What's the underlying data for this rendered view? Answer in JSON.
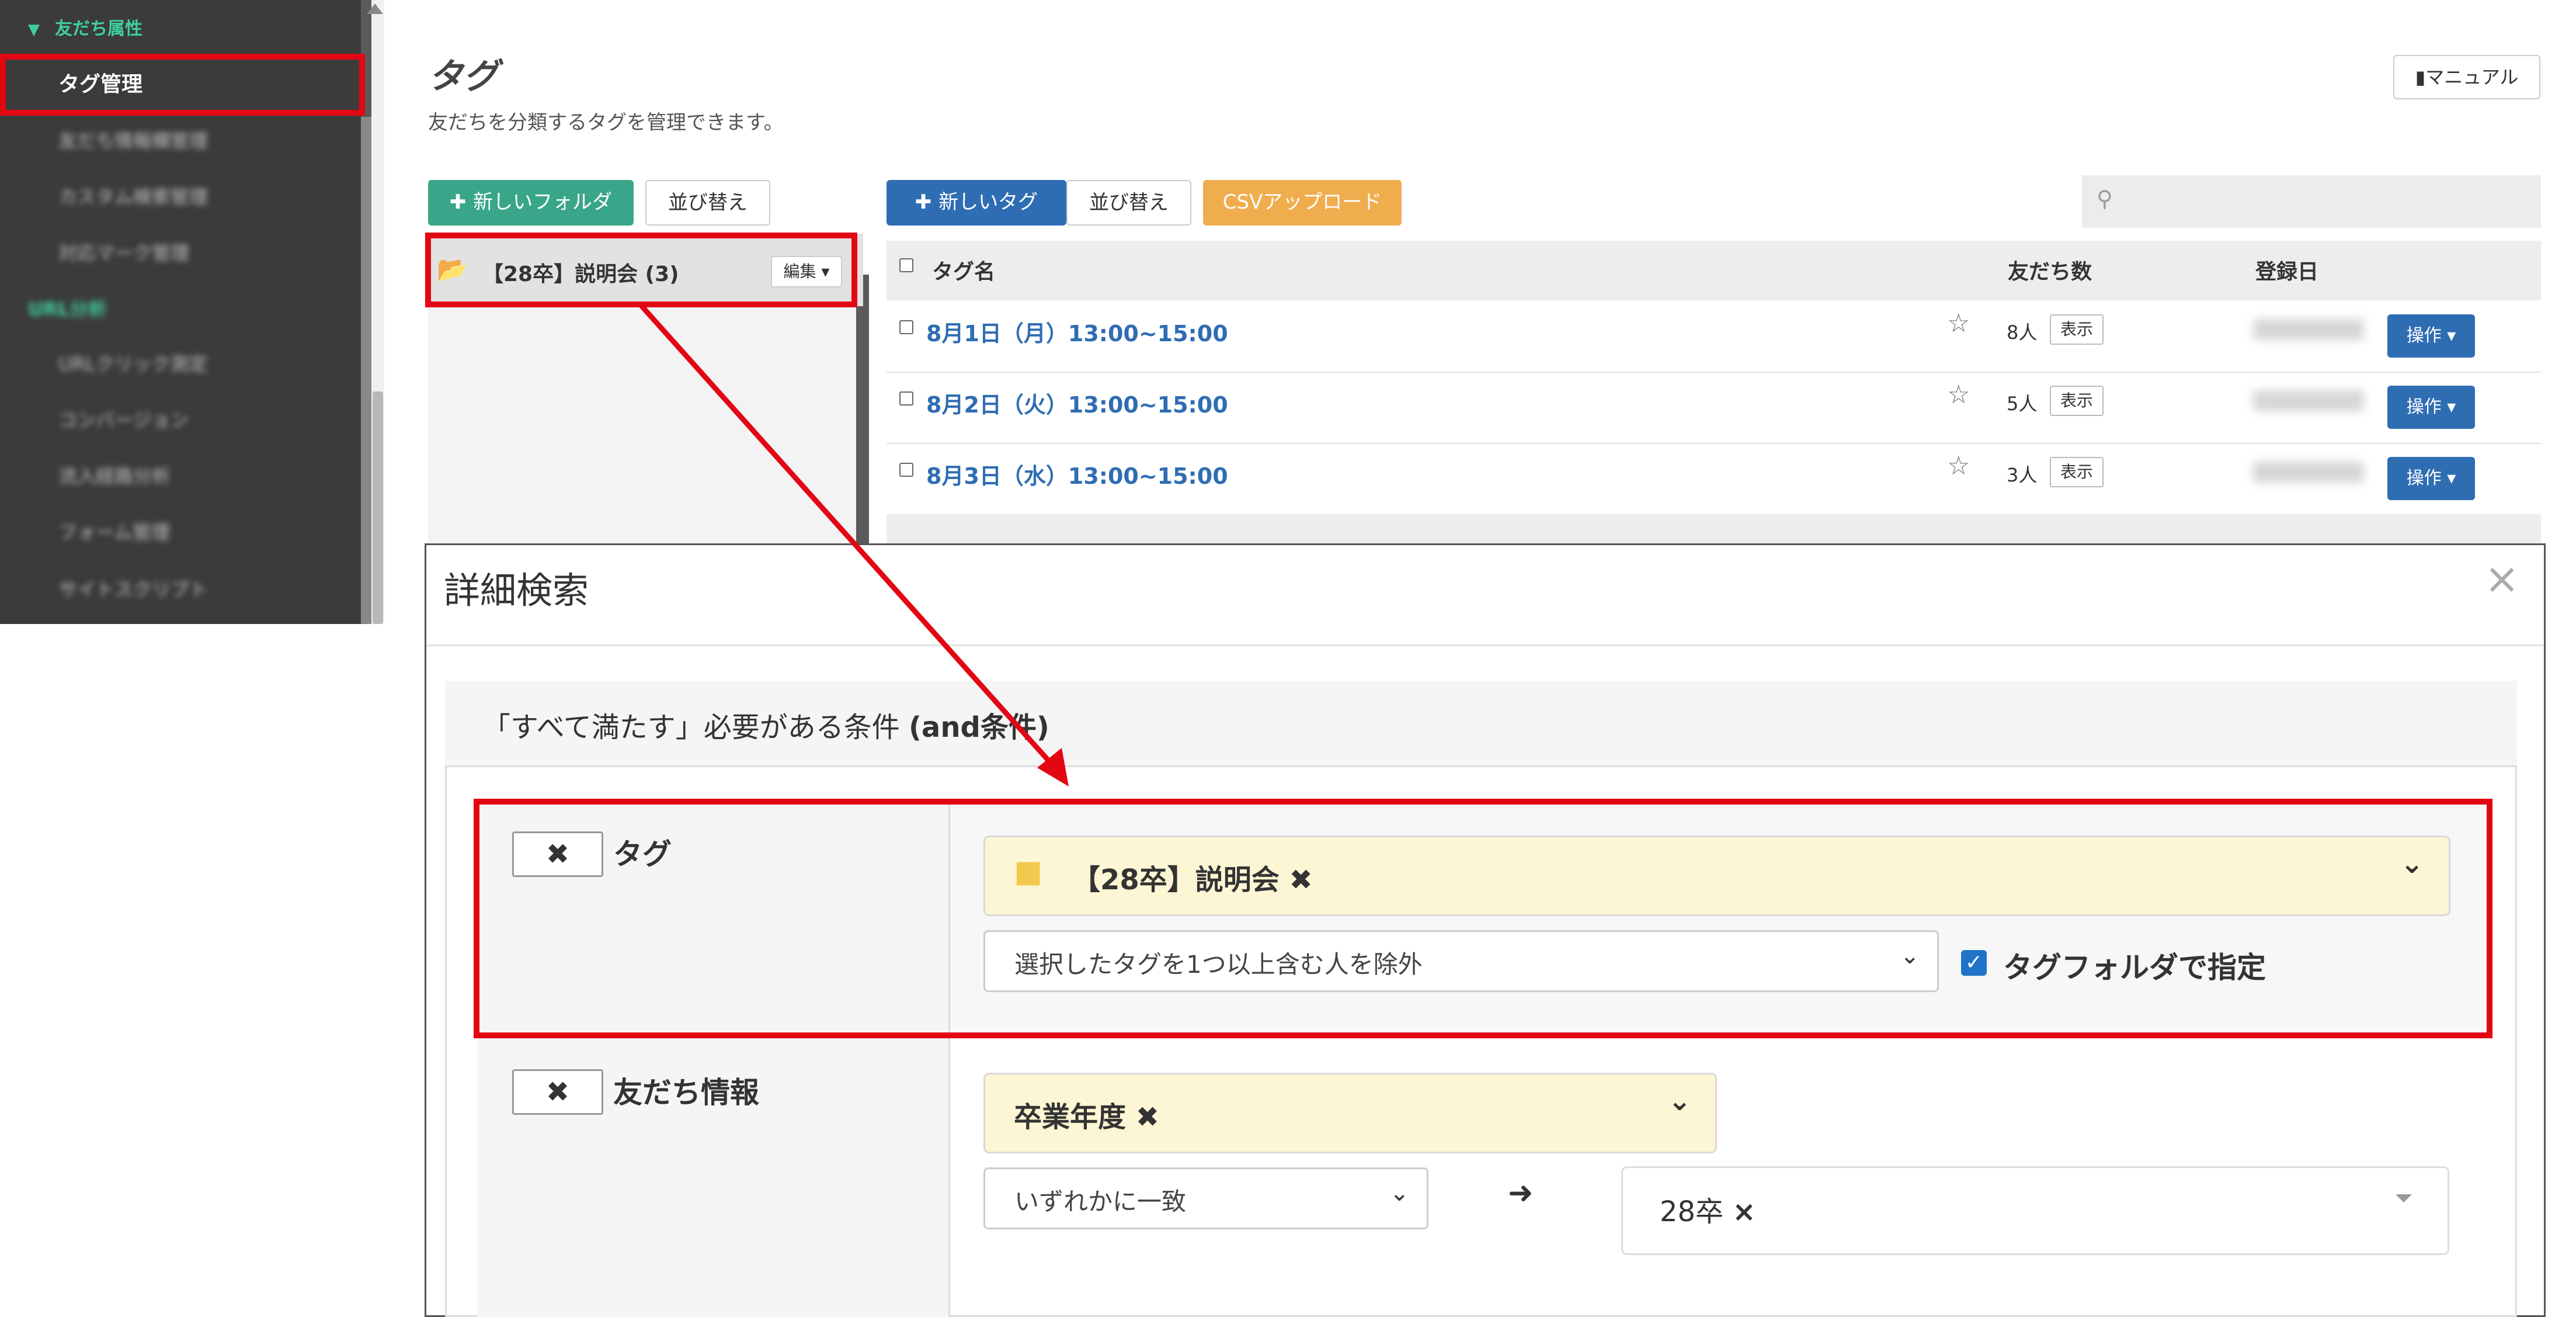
{
  "sidebar": {
    "section_label": "友だち属性",
    "active_item": "タグ管理",
    "blurred_items": [
      "友だち情報欄管理",
      "カスタム検索管理",
      "対応マーク管理",
      "URL分析",
      "URLクリック測定",
      "コンバージョン",
      "流入経路分析",
      "フォーム管理",
      "サイトスクリプト"
    ]
  },
  "header": {
    "title": "タグ",
    "subtitle": "友だちを分類するタグを管理できます。",
    "manual_button": "マニュアル"
  },
  "toolbar": {
    "new_folder": "新しいフォルダ",
    "sort_folders": "並び替え",
    "new_tag": "新しいタグ",
    "sort_tags": "並び替え",
    "csv_upload": "CSVアップロード"
  },
  "folders": [
    {
      "label": "【28卒】説明会 (3)",
      "edit": "編集"
    }
  ],
  "tag_table": {
    "columns": {
      "name": "タグ名",
      "friends": "友だち数",
      "date": "登録日"
    },
    "rows": [
      {
        "name": "8月1日（月）13:00~15:00",
        "count": "8人",
        "show": "表示",
        "op": "操作"
      },
      {
        "name": "8月2日（火）13:00~15:00",
        "count": "5人",
        "show": "表示",
        "op": "操作"
      },
      {
        "name": "8月3日（水）13:00~15:00",
        "count": "3人",
        "show": "表示",
        "op": "操作"
      }
    ]
  },
  "modal": {
    "title": "詳細検索",
    "close": "×",
    "condition_header_prefix": "「すべて満たす」必要がある条件 ",
    "condition_header_bold": "(and条件)",
    "tag_section": {
      "label": "タグ",
      "remove": "✖",
      "chip": "【28卒】説明会",
      "chip_remove": "✖",
      "mode_select": "選択したタグを1つ以上含む人を除外",
      "folder_checkbox_label": "タグフォルダで指定"
    },
    "friend_section": {
      "label": "友だち情報",
      "remove": "✖",
      "chip": "卒業年度",
      "chip_remove": "✖",
      "match_select": "いずれかに一致",
      "arrow": "➜",
      "value": "28卒",
      "value_remove": "×"
    }
  },
  "colors": {
    "annotation_red": "#e30613",
    "sidebar_bg": "#3b3b3b",
    "accent_green": "#3aa689",
    "primary_blue": "#2f6db3",
    "csv_orange": "#f0ad4e",
    "chip_yellow": "#fdf6d4",
    "checkbox_blue": "#1f73c9"
  }
}
